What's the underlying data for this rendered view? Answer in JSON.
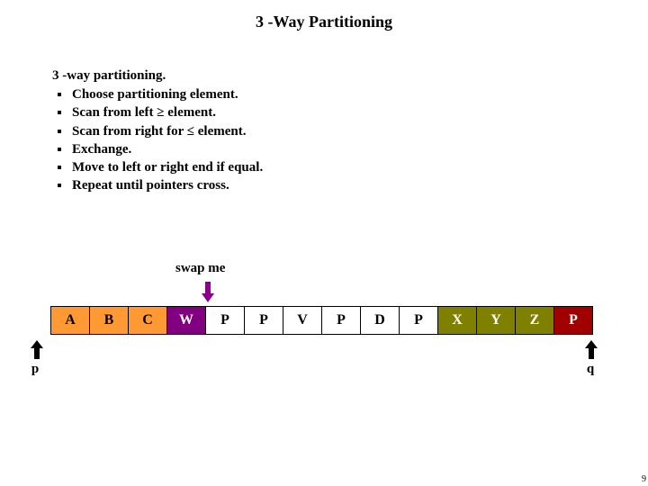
{
  "title": "3 -Way Partitioning",
  "heading": "3 -way partitioning.",
  "bullets": [
    "Choose partitioning element.",
    "Scan from left ≥ element.",
    "Scan from right for ≤  element.",
    "Exchange.",
    "Move to left or right end if equal.",
    "Repeat until pointers cross."
  ],
  "swap_label": "swap me",
  "array": [
    {
      "v": "A",
      "c": "orange"
    },
    {
      "v": "B",
      "c": "orange"
    },
    {
      "v": "C",
      "c": "orange"
    },
    {
      "v": "W",
      "c": "purple"
    },
    {
      "v": "P",
      "c": "white"
    },
    {
      "v": "P",
      "c": "white"
    },
    {
      "v": "V",
      "c": "white"
    },
    {
      "v": "P",
      "c": "white"
    },
    {
      "v": "D",
      "c": "white"
    },
    {
      "v": "P",
      "c": "white"
    },
    {
      "v": "X",
      "c": "olive"
    },
    {
      "v": "Y",
      "c": "olive"
    },
    {
      "v": "Z",
      "c": "olive"
    },
    {
      "v": "P",
      "c": "maroon"
    }
  ],
  "pointers": {
    "left": "p",
    "right": "q"
  },
  "page_number": "9"
}
